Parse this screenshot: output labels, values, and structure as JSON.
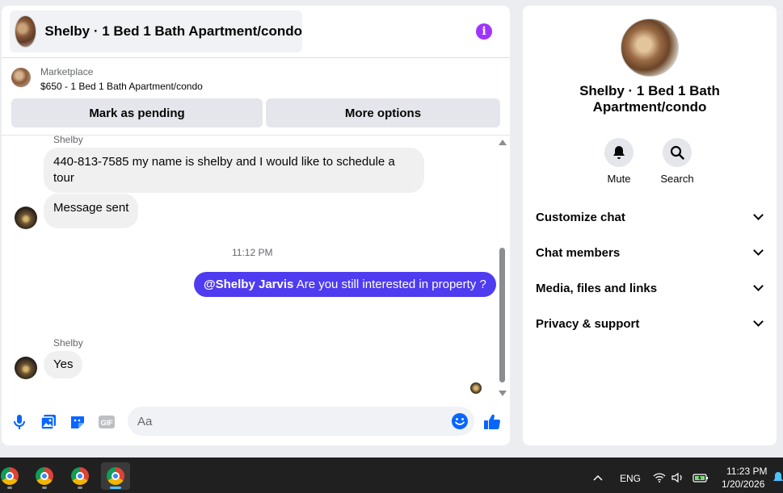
{
  "chat": {
    "title": "Shelby · 1 Bed 1 Bath Apartment/condo",
    "marketplace_label": "Marketplace",
    "listing": "$650 - 1 Bed 1 Bath Apartment/condo",
    "mark_pending_label": "Mark as pending",
    "more_options_label": "More options",
    "messages": [
      {
        "sender": "Shelby",
        "text": "440-813-7585 my name is shelby and I would like to schedule a tour"
      },
      {
        "text": "Message sent"
      },
      {
        "timestamp": "11:12 PM"
      },
      {
        "mention": "@Shelby Jarvis",
        "text": " Are you still interested in property ?"
      },
      {
        "sender": "Shelby",
        "text": "Yes"
      }
    ],
    "composer_placeholder": "Aa",
    "composer_icons": [
      "microphone-icon",
      "photo-icon",
      "sticker-icon",
      "gif-icon",
      "emoji-icon",
      "thumbs-up-icon"
    ],
    "accent_color": "#4f3cf0"
  },
  "info": {
    "title": "Shelby · 1 Bed 1 Bath Apartment/condo",
    "actions": [
      {
        "label": "Mute",
        "icon": "bell-icon"
      },
      {
        "label": "Search",
        "icon": "search-icon"
      }
    ],
    "rows": [
      "Customize chat",
      "Chat members",
      "Media, files and links",
      "Privacy & support"
    ]
  },
  "taskbar": {
    "language": "ENG",
    "time": "11:23 PM",
    "date": "1/20/2026"
  }
}
